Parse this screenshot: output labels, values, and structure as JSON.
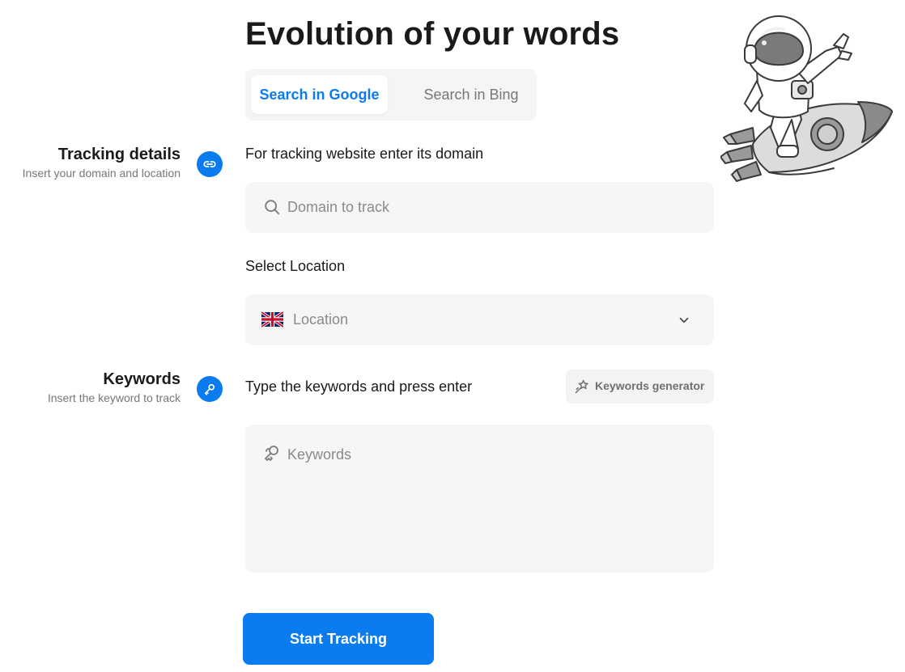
{
  "page": {
    "title": "Evolution of your words"
  },
  "tabs": [
    {
      "label": "Search in Google",
      "active": true
    },
    {
      "label": "Search in Bing",
      "active": false
    }
  ],
  "sections": {
    "tracking": {
      "title": "Tracking details",
      "subtitle": "Insert your domain and location",
      "icon": "link-icon"
    },
    "keywords": {
      "title": "Keywords",
      "subtitle": "Insert the keyword to track",
      "icon": "key-icon"
    }
  },
  "domain": {
    "label": "For tracking website enter its domain",
    "placeholder": "Domain to track",
    "value": ""
  },
  "location": {
    "label": "Select Location",
    "placeholder": "Location",
    "flag": "uk-flag-icon"
  },
  "keywords": {
    "label": "Type the keywords and press enter",
    "generator_label": "Keywords generator",
    "placeholder": "Keywords"
  },
  "actions": {
    "start_label": "Start Tracking"
  },
  "colors": {
    "accent": "#0a7cf0",
    "field_bg": "#f6f6f6"
  }
}
